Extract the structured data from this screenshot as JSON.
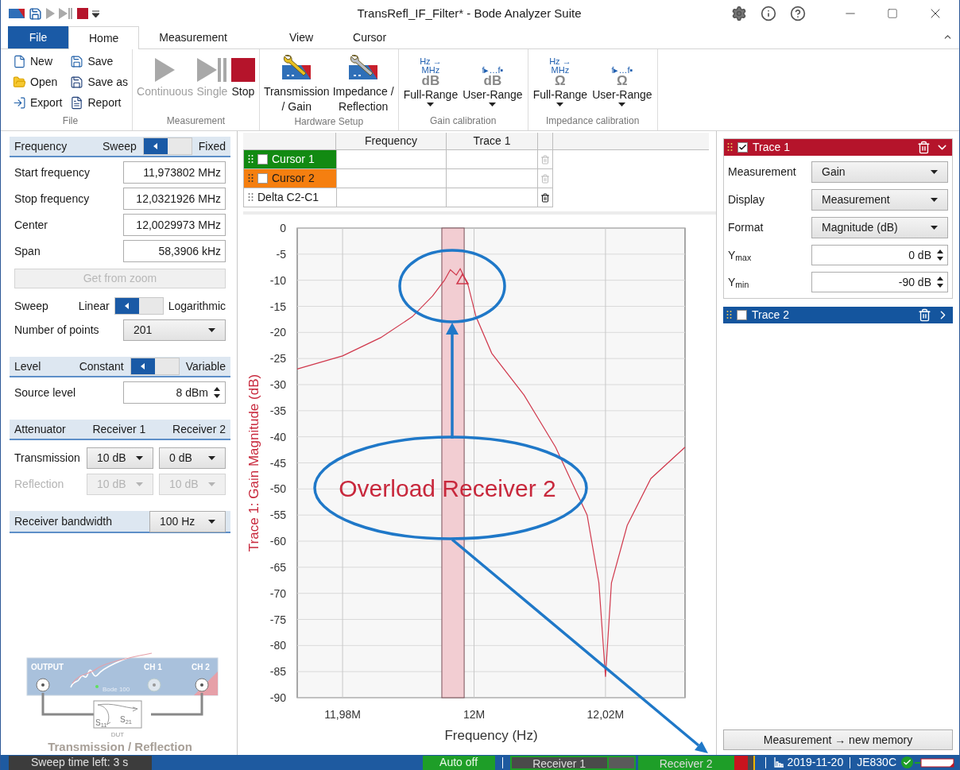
{
  "window": {
    "title": "TransRefl_IF_Filter* - Bode Analyzer Suite"
  },
  "ribbon_tabs": [
    {
      "label": "File",
      "kind": "backstage",
      "selected": false
    },
    {
      "label": "Home",
      "kind": "tab",
      "selected": true
    },
    {
      "label": "Measurement",
      "kind": "tab",
      "selected": false
    },
    {
      "label": "View",
      "kind": "tab",
      "selected": false
    },
    {
      "label": "Cursor",
      "kind": "tab",
      "selected": false
    }
  ],
  "ribbon_groups": [
    {
      "label": "File",
      "kind": "small",
      "items": [
        {
          "label": "New",
          "kind": "new"
        },
        {
          "label": "Open",
          "kind": "open"
        },
        {
          "label": "Export",
          "kind": "export"
        },
        {
          "label": "Save",
          "kind": "save"
        },
        {
          "label": "Save as",
          "kind": "save_as"
        },
        {
          "label": "Report",
          "kind": "report"
        }
      ]
    },
    {
      "label": "Measurement",
      "kind": "large",
      "items": [
        {
          "lines": [
            "Continuous"
          ],
          "kind": "play",
          "disabled": true
        },
        {
          "lines": [
            "Single"
          ],
          "kind": "single",
          "disabled": true
        },
        {
          "lines": [
            "Stop"
          ],
          "kind": "stop",
          "disabled": false
        }
      ]
    },
    {
      "label": "Hardware Setup",
      "kind": "large",
      "items": [
        {
          "lines": [
            "Transmission",
            "/ Gain"
          ],
          "kind": "gain_setup",
          "disabled": false
        },
        {
          "lines": [
            "Impedance /",
            "Reflection"
          ],
          "kind": "impedance_setup",
          "disabled": false
        }
      ]
    },
    {
      "label": "Gain calibration",
      "kind": "calibration",
      "items": [
        {
          "glyph": [
            "Hz →",
            "MHz"
          ],
          "unit": "dB",
          "label": "Full-Range"
        },
        {
          "glyph": [
            "f▸…f▪"
          ],
          "unit": "dB",
          "label": "User-Range"
        }
      ]
    },
    {
      "label": "Impedance calibration",
      "kind": "calibration",
      "items": [
        {
          "glyph": [
            "Hz →",
            "MHz"
          ],
          "unit": "Ω",
          "label": "Full-Range"
        },
        {
          "glyph": [
            "f▸…f▪"
          ],
          "unit": "Ω",
          "label": "User-Range"
        }
      ]
    }
  ],
  "settings": [
    {
      "kind": "header",
      "label": "Frequency",
      "options": [
        {
          "label": "Sweep",
          "selected": true
        },
        {
          "label": "Fixed",
          "selected": false
        }
      ]
    },
    {
      "kind": "field",
      "label": "Start frequency",
      "value": "11,973802 MHz"
    },
    {
      "kind": "field",
      "label": "Stop frequency",
      "value": "12,0321926 MHz"
    },
    {
      "kind": "field",
      "label": "Center",
      "value": "12,0029973 MHz"
    },
    {
      "kind": "field",
      "label": "Span",
      "value": "58,3906 kHz"
    },
    {
      "kind": "button",
      "label": "Get from zoom",
      "disabled": true
    },
    {
      "kind": "toggle",
      "label": "Sweep",
      "options": [
        {
          "label": "Linear",
          "selected": true
        },
        {
          "label": "Logarithmic",
          "selected": false
        }
      ]
    },
    {
      "kind": "select",
      "label": "Number of points",
      "value": "201"
    },
    {
      "kind": "header",
      "label": "Level",
      "options": [
        {
          "label": "Constant",
          "selected": true
        },
        {
          "label": "Variable",
          "selected": false
        }
      ]
    },
    {
      "kind": "spin",
      "label": "Source level",
      "value": "8 dBm"
    },
    {
      "kind": "columns_header",
      "label": "Attenuator",
      "columns": [
        "Receiver 1",
        "Receiver 2"
      ]
    },
    {
      "kind": "select_pair",
      "label": "Transmission",
      "values": [
        "10 dB",
        "0 dB"
      ],
      "disabled": false
    },
    {
      "kind": "select_pair",
      "label": "Reflection",
      "values": [
        "10 dB",
        "10 dB"
      ],
      "disabled": true
    },
    {
      "kind": "header_select",
      "label": "Receiver bandwidth",
      "value": "100 Hz"
    }
  ],
  "diagram": {
    "output": "OUTPUT",
    "ch1": "CH 1",
    "ch2": "CH 2",
    "device": "Bode 100",
    "s11": "S$_{11}$",
    "s21": "S$_{21}$",
    "dut": "DUT",
    "title": "Transmission / Reflection"
  },
  "cursor_table": {
    "columns": [
      "Frequency",
      "Trace 1"
    ],
    "rows": [
      {
        "label": "Cursor 1",
        "color": "#128a12",
        "checked": false,
        "deletable": false
      },
      {
        "label": "Cursor 2",
        "color": "#f57f10",
        "checked": false,
        "deletable": false
      },
      {
        "label": "Delta C2-C1",
        "deletable": true
      }
    ]
  },
  "chart_data": {
    "type": "line",
    "xlabel": "Frequency (Hz)",
    "ylabel": "Trace 1: Gain Magnitude (dB)",
    "xlim": [
      11.9731,
      12.0321
    ],
    "ylim": [
      -90,
      0
    ],
    "xticks": [
      {
        "value": 11.98,
        "label": "11,98M"
      },
      {
        "value": 12,
        "label": "12M"
      },
      {
        "value": 12.02,
        "label": "12,02M"
      }
    ],
    "yticks": [
      0,
      -5,
      -10,
      -15,
      -20,
      -25,
      -30,
      -35,
      -40,
      -45,
      -50,
      -55,
      -60,
      -65,
      -70,
      -75,
      -80,
      -85,
      -90
    ],
    "x": [
      11.9731,
      11.98,
      11.9858,
      11.9906,
      11.9937,
      11.9955,
      11.9964,
      11.9973,
      11.9979,
      11.9991,
      12.0003,
      12.0027,
      12.0076,
      12.0124,
      12.0172,
      12.019,
      12.02,
      12.0209,
      12.0233,
      12.0269,
      12.0321
    ],
    "series": [
      {
        "color": "#d0384c",
        "values": [
          -27,
          -24.5,
          -21,
          -17,
          -13,
          -10,
          -8,
          -9,
          -7.8,
          -11,
          -17,
          -24,
          -32,
          -42,
          -55,
          -68,
          -86,
          -68,
          -57,
          -48,
          -42
        ]
      }
    ],
    "grid": true,
    "bands": [
      {
        "axis": "x",
        "from": 11.9951,
        "to": 11.9985
      }
    ],
    "annotations": [
      {
        "text": "Overload Receiver 2"
      }
    ]
  },
  "traces": [
    {
      "name": "Trace 1",
      "color": "#b5142b",
      "checked": true,
      "expanded": true,
      "fields": [
        {
          "label": "Measurement",
          "kind": "select",
          "value": "Gain"
        },
        {
          "label": "Display",
          "kind": "select",
          "value": "Measurement"
        },
        {
          "label": "Format",
          "kind": "select",
          "value": "Magnitude (dB)"
        },
        {
          "label": "Y$_{max}$",
          "kind": "spin",
          "value": "0 dB"
        },
        {
          "label": "Y$_{min}$",
          "kind": "spin",
          "value": "-90 dB"
        }
      ]
    },
    {
      "name": "Trace 2",
      "color": "#14559e",
      "checked": false,
      "expanded": false
    }
  ],
  "memory_button": "Measurement → new memory",
  "status_bar": {
    "sweep_time": "Sweep time left: 3 s",
    "auto": "Auto off",
    "receivers": [
      {
        "label": "Receiver 1",
        "active": false,
        "overload": false
      },
      {
        "label": "Receiver 2",
        "active": true,
        "overload": true
      }
    ],
    "date": "2019-11-20",
    "device": "JE830C",
    "connected": true
  }
}
